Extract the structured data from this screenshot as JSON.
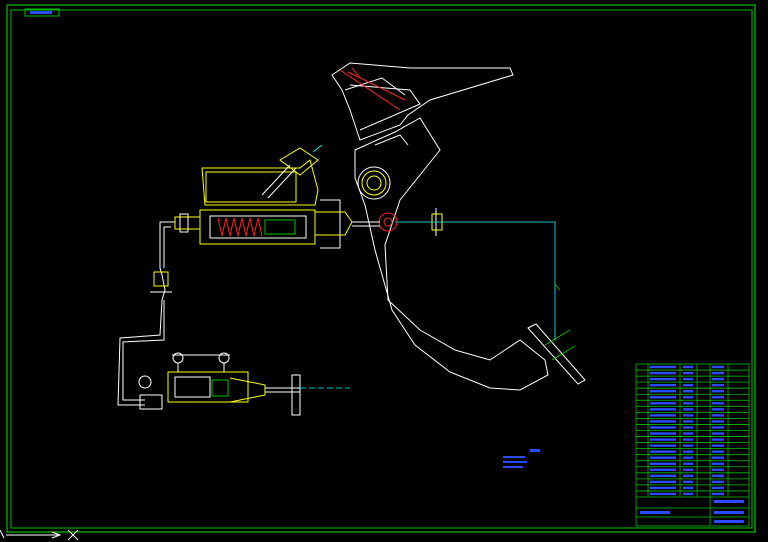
{
  "drawing": {
    "title_tag_text": "",
    "technical_note_text": "",
    "title_block": {
      "rows": 22,
      "cells_text": []
    }
  },
  "palette": {
    "background": "#000000",
    "frame": "#00c000",
    "outline": "#ffffff",
    "part": "#ffff00",
    "axis": "#00ffff",
    "accent": "#ff2020",
    "annotation": "#2a4bff",
    "hatch": "#00c000"
  }
}
